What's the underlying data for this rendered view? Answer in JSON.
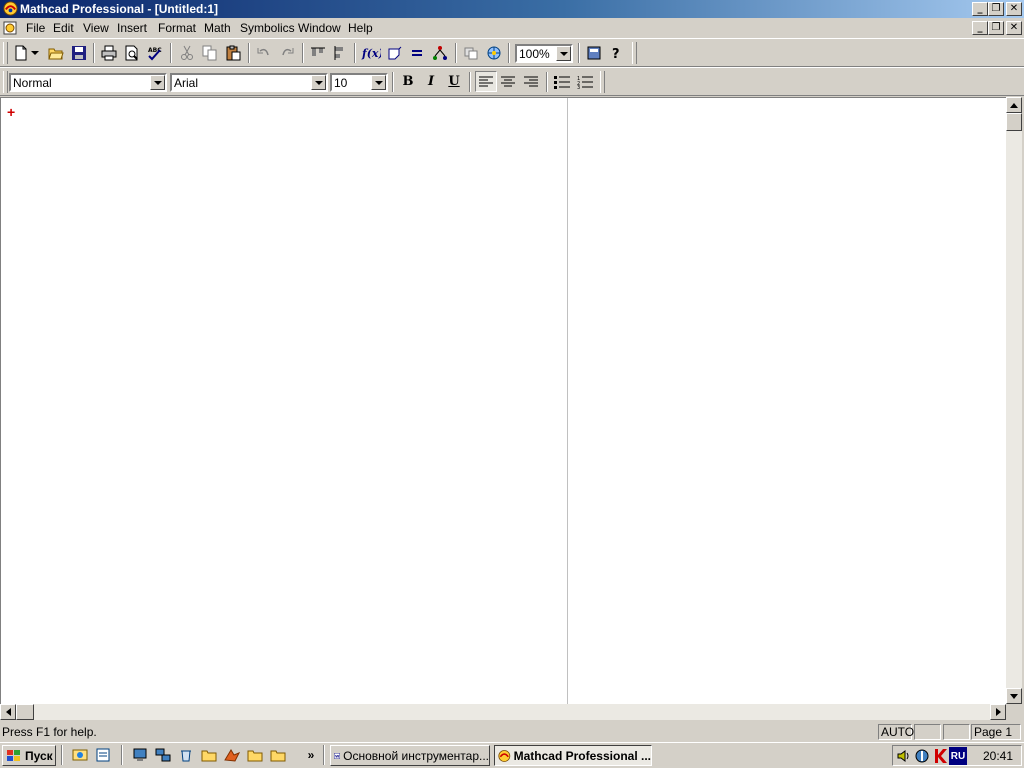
{
  "window": {
    "title": "Mathcad Professional - [Untitled:1]",
    "accent": "#0a246a"
  },
  "menu": {
    "items": [
      "File",
      "Edit",
      "View",
      "Insert",
      "Format",
      "Math",
      "Symbolics",
      "Window",
      "Help"
    ]
  },
  "toolbar": {
    "zoom": "100%",
    "icons": [
      "new-icon",
      "open-icon",
      "save-icon",
      "print-icon",
      "print-preview-icon",
      "spell-check-icon",
      "cut-icon",
      "copy-icon",
      "paste-icon",
      "undo-icon",
      "redo-icon",
      "align-across-icon",
      "align-down-icon",
      "insert-function-icon",
      "insert-unit-icon",
      "calculate-icon",
      "insert-component-icon",
      "resource-center-icon",
      "help-icon"
    ]
  },
  "format": {
    "style": "Normal",
    "font": "Arial",
    "size": "10",
    "bold": "B",
    "italic": "I",
    "underline": "U"
  },
  "worksheet": {
    "cursor": "+",
    "cursor_color": "#d00000"
  },
  "status": {
    "help": "Press F1 for help.",
    "mode": "AUTO",
    "page": "Page 1"
  },
  "taskbar": {
    "start": "Пуск",
    "chevron": "»",
    "tasks": [
      {
        "label": "Основной инструментар...",
        "active": false
      },
      {
        "label": "Mathcad Professional ...",
        "active": true
      }
    ],
    "tray_lang": "RU",
    "clock": "20:41"
  }
}
